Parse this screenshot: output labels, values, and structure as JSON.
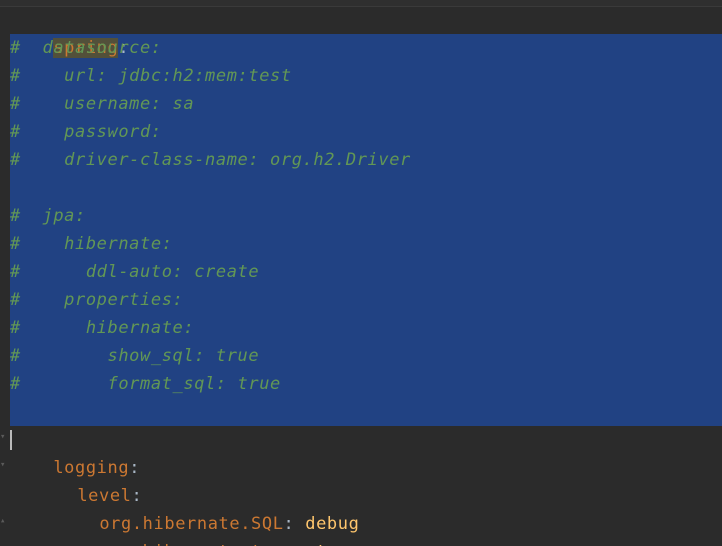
{
  "editor": {
    "lines": [
      {
        "id": "spring",
        "key": "spring",
        "colon": ":"
      },
      {
        "id": "c1",
        "text": "#  datasource:"
      },
      {
        "id": "c2",
        "text": "#    url: jdbc:h2:mem:test"
      },
      {
        "id": "c3",
        "text": "#    username: sa"
      },
      {
        "id": "c4",
        "text": "#    password:"
      },
      {
        "id": "c5",
        "text": "#    driver-class-name: org.h2.Driver"
      },
      {
        "id": "blank",
        "text": ""
      },
      {
        "id": "c6",
        "text": "#  jpa:"
      },
      {
        "id": "c7",
        "text": "#    hibernate:"
      },
      {
        "id": "c8",
        "text": "#      ddl-auto: create"
      },
      {
        "id": "c9",
        "text": "#    properties:"
      },
      {
        "id": "c10",
        "text": "#      hibernate:"
      },
      {
        "id": "c11",
        "text": "#        show_sql: true"
      },
      {
        "id": "c12",
        "text": "#        format_sql: true"
      }
    ],
    "logging": {
      "key": "logging",
      "colon": ":"
    },
    "level": {
      "key": "level",
      "colon": ":"
    },
    "sql": {
      "key": "org.hibernate.SQL",
      "colon": ":",
      "value": "debug"
    },
    "type": {
      "key": "org.hibernate.type",
      "colon": ":",
      "value": "trace"
    },
    "colors": {
      "background": "#2b2b2b",
      "selection": "#214283",
      "key": "#cc7832",
      "comment": "#629755",
      "value": "#ffc66d"
    }
  }
}
